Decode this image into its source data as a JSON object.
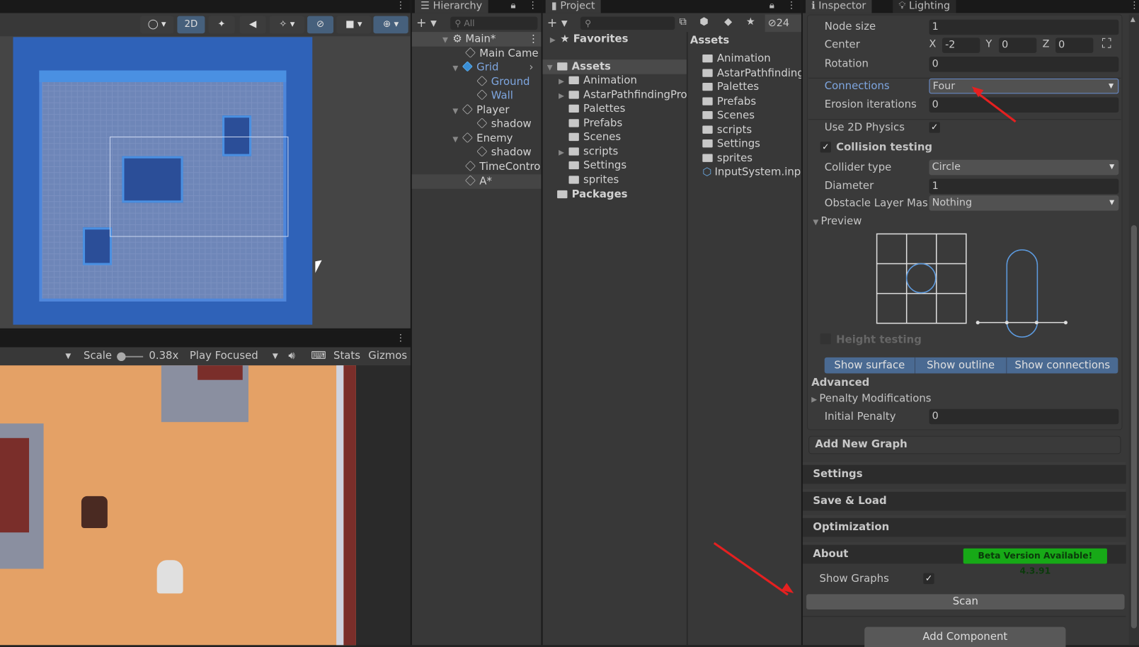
{
  "scene": {
    "toolbar": {
      "mode_2d": "2D"
    }
  },
  "game": {
    "toolbar": {
      "scale_label": "Scale",
      "scale_value": "0.38x",
      "play_mode": "Play Focused",
      "stats": "Stats",
      "gizmos": "Gizmos"
    }
  },
  "hierarchy": {
    "tab": "Hierarchy",
    "search_placeholder": "All",
    "items": [
      {
        "label": "Main*"
      },
      {
        "label": "Main Came"
      },
      {
        "label": "Grid"
      },
      {
        "label": "Ground"
      },
      {
        "label": "Wall"
      },
      {
        "label": "Player"
      },
      {
        "label": "shadow"
      },
      {
        "label": "Enemy"
      },
      {
        "label": "shadow"
      },
      {
        "label": "TimeContro"
      },
      {
        "label": "A*"
      }
    ]
  },
  "project": {
    "tab": "Project",
    "hidden_count": "24",
    "favorites": "Favorites",
    "tree_root": "Assets",
    "tree": [
      "Animation",
      "AstarPathfindingPro",
      "Palettes",
      "Prefabs",
      "Scenes",
      "scripts",
      "Settings",
      "sprites"
    ],
    "packages": "Packages",
    "list_header": "Assets",
    "list": [
      "Animation",
      "AstarPathfinding",
      "Palettes",
      "Prefabs",
      "Scenes",
      "scripts",
      "Settings",
      "sprites",
      "InputSystem.inpu"
    ]
  },
  "inspector": {
    "tab": "Inspector",
    "tab2": "Lighting",
    "node_size": {
      "label": "Node size",
      "value": "1"
    },
    "center": {
      "label": "Center",
      "x": "-2",
      "y": "0",
      "z": "0",
      "xl": "X",
      "yl": "Y",
      "zl": "Z"
    },
    "rotation": {
      "label": "Rotation",
      "value": "0"
    },
    "connections": {
      "label": "Connections",
      "value": "Four"
    },
    "erosion": {
      "label": "Erosion iterations",
      "value": "0"
    },
    "use2d": {
      "label": "Use 2D Physics",
      "checked": true
    },
    "collision": {
      "label": "Collision testing",
      "checked": true
    },
    "collider": {
      "label": "Collider type",
      "value": "Circle"
    },
    "diameter": {
      "label": "Diameter",
      "value": "1"
    },
    "obstacle": {
      "label": "Obstacle Layer Mas",
      "value": "Nothing"
    },
    "preview": "Preview",
    "height_testing": "Height testing",
    "show_surface": "Show surface",
    "show_outline": "Show outline",
    "show_connections": "Show connections",
    "advanced": "Advanced",
    "penalty_mod": "Penalty Modifications",
    "initial_penalty": {
      "label": "Initial Penalty",
      "value": "0"
    },
    "add_graph": "Add New Graph",
    "sections": [
      "Settings",
      "Save & Load",
      "Optimization",
      "About"
    ],
    "beta_badge": "Beta Version Available! 4.3.91",
    "show_graphs": {
      "label": "Show Graphs",
      "checked": true
    },
    "scan": "Scan",
    "add_component": "Add Component",
    "colors": {
      "accent": "#7ea6e0",
      "badge": "#17a917",
      "annotation_arrow": "#e52020"
    }
  }
}
